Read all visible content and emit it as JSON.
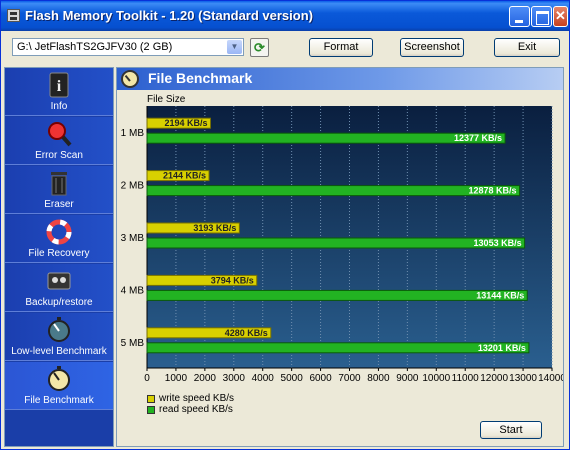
{
  "window": {
    "title": "Flash Memory Toolkit - 1.20 (Standard version)"
  },
  "toolbar": {
    "drive_value": "G:\\ JetFlashTS2GJFV30 (2 GB)",
    "format_label": "Format",
    "screenshot_label": "Screenshot",
    "exit_label": "Exit"
  },
  "sidebar": {
    "items": [
      {
        "label": "Info",
        "icon": "info-icon"
      },
      {
        "label": "Error Scan",
        "icon": "magnifier-icon"
      },
      {
        "label": "Eraser",
        "icon": "trash-icon"
      },
      {
        "label": "File Recovery",
        "icon": "lifebuoy-icon"
      },
      {
        "label": "Backup/restore",
        "icon": "tape-icon"
      },
      {
        "label": "Low-level Benchmark",
        "icon": "stopwatch-icon"
      },
      {
        "label": "File Benchmark",
        "icon": "stopwatch-icon",
        "active": true
      }
    ]
  },
  "panel": {
    "title": "File Benchmark",
    "start_label": "Start"
  },
  "chart_data": {
    "type": "bar",
    "orientation": "horizontal",
    "ylabel": "File Size",
    "categories": [
      "1 MB",
      "2 MB",
      "3 MB",
      "4 MB",
      "5 MB"
    ],
    "series": [
      {
        "name": "write speed KB/s",
        "color": "#d8d000",
        "values": [
          2194,
          2144,
          3193,
          3794,
          4280
        ],
        "labels": [
          "2194 KB/s",
          "2144 KB/s",
          "3193 KB/s",
          "3794 KB/s",
          "4280 KB/s"
        ]
      },
      {
        "name": "read speed KB/s",
        "color": "#22b322",
        "values": [
          12377,
          12878,
          13053,
          13144,
          13201
        ],
        "labels": [
          "12377 KB/s",
          "12878 KB/s",
          "13053 KB/s",
          "13144 KB/s",
          "13201 KB/s"
        ]
      }
    ],
    "xlim": [
      0,
      14000
    ],
    "xticks": [
      0,
      1000,
      2000,
      3000,
      4000,
      5000,
      6000,
      7000,
      8000,
      9000,
      10000,
      11000,
      12000,
      13000,
      14000
    ],
    "grid": true,
    "legend": "bottom-left"
  }
}
